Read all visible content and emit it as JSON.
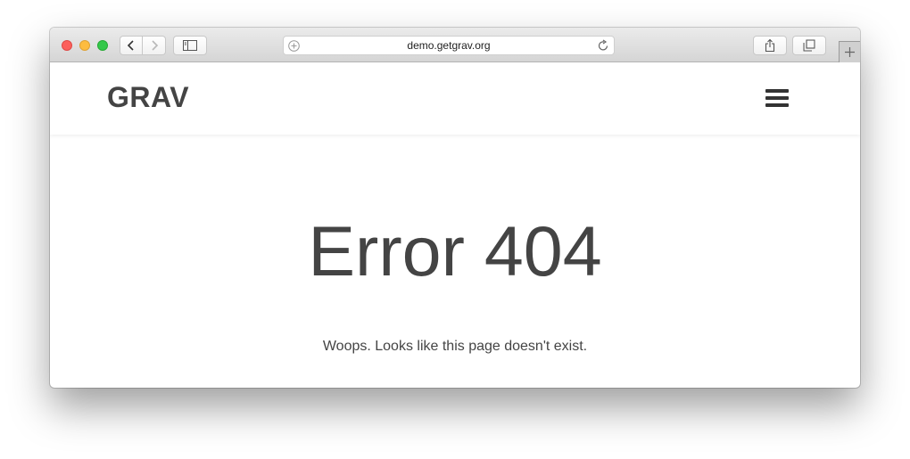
{
  "browser": {
    "address_url": "demo.getgrav.org",
    "icons": [
      "back-icon",
      "forward-icon",
      "sidebar-icon",
      "add-icon",
      "reload-icon",
      "share-icon",
      "tabs-icon",
      "new-tab-icon"
    ],
    "colors": {
      "close": "#fc605c",
      "minimize": "#fdbc40",
      "maximize": "#34c84a"
    }
  },
  "site": {
    "logo": "GRAV",
    "menu_icon": "hamburger-menu-icon",
    "text_color": "#444444"
  },
  "page": {
    "title": "Error 404",
    "message": "Woops. Looks like this page doesn't exist."
  }
}
